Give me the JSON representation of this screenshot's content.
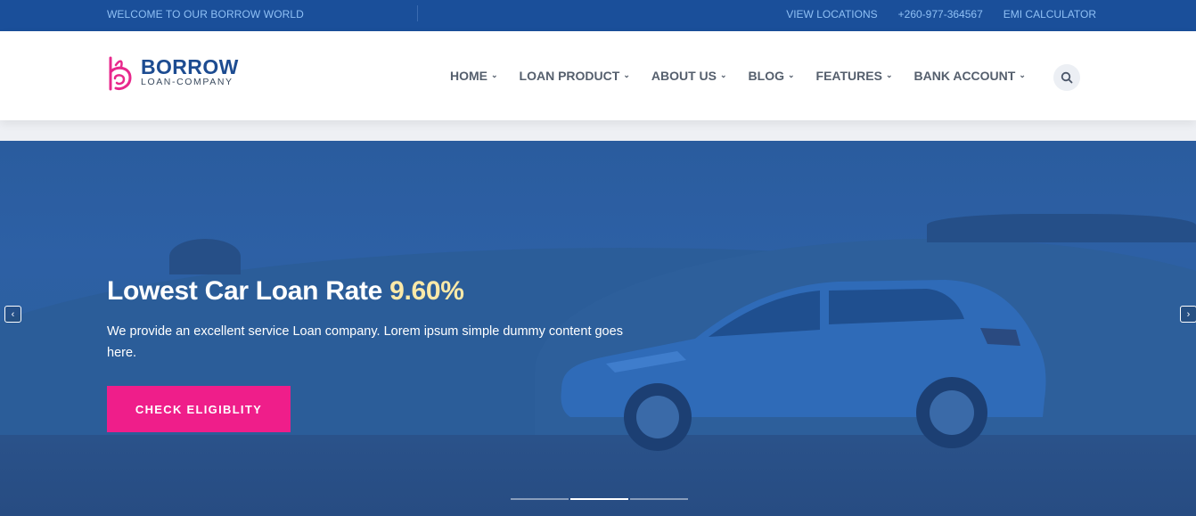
{
  "topbar": {
    "welcome": "WELCOME TO OUR BORROW WORLD",
    "links": [
      "VIEW LOCATIONS",
      "+260-977-364567",
      "EMI CALCULATOR"
    ]
  },
  "logo": {
    "brand": "BORROW",
    "tagline": "LOAN-COMPANY"
  },
  "nav": {
    "items": [
      "HOME",
      "LOAN PRODUCT",
      "ABOUT US",
      "BLOG",
      "FEATURES",
      "BANK ACCOUNT"
    ]
  },
  "search": {
    "icon": "search-icon"
  },
  "hero": {
    "title": "Lowest Car Loan Rate",
    "rate": "9.60%",
    "description": "We provide an excellent service Loan company. Lorem ipsum simple dummy content goes here.",
    "cta": "CHECK ELIGIBLITY",
    "slides": 3,
    "active_slide": 2
  },
  "colors": {
    "topbar": "#1a4f9a",
    "topbar_text": "#8fc0f5",
    "brand": "#1d4c91",
    "accent": "#ef1e8a",
    "rate_highlight": "#fbe9a8"
  }
}
